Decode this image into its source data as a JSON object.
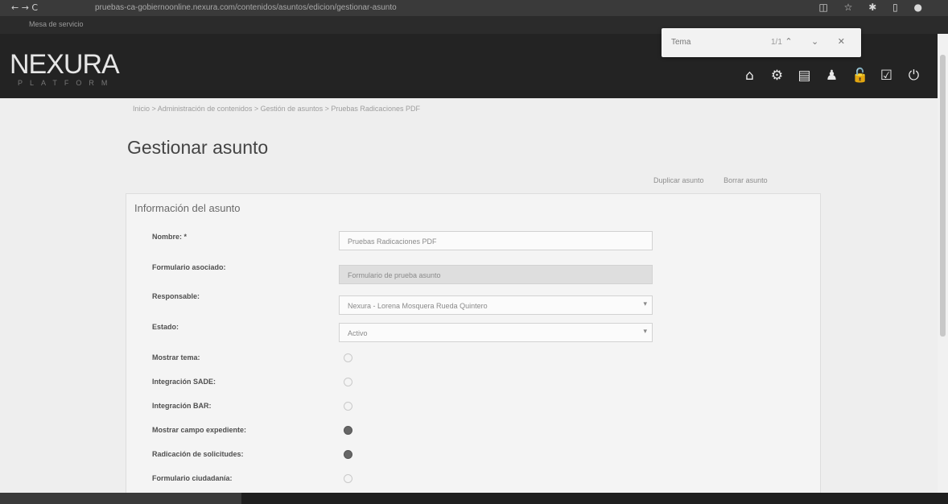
{
  "browser": {
    "nav": "←  →  C",
    "url": "pruebas-ca-gobiernoonline.nexura.com/contenidos/asuntos/edicion/gestionar-asunto",
    "icons": "◫ ☆ ✱ ▯ ●"
  },
  "bookmarks": {
    "label": "Mesa de servicio"
  },
  "find": {
    "query": "Tema",
    "count": "1/1",
    "buttons": "⌃ ⌄ ✕"
  },
  "header": {
    "logo": "NEXURA",
    "logo_sub": "PLATFORM",
    "icons": [
      "home-icon",
      "gear-icon",
      "book-icon",
      "user-icon",
      "unlock-icon",
      "check-square-icon",
      "power-icon"
    ],
    "icon_glyphs": [
      "⌂",
      "⚙",
      "▤",
      "♟",
      "🔓",
      "☑",
      "⏻"
    ]
  },
  "breadcrumb": "Inicio > Administración de contenidos > Gestión de asuntos > Pruebas Radicaciones PDF",
  "page": {
    "title": "Gestionar asunto",
    "actions": [
      "Duplicar asunto",
      "Borrar asunto"
    ]
  },
  "form": {
    "panel_title": "Información del asunto",
    "fields": {
      "nombre": {
        "label": "Nombre: *",
        "value": "Pruebas Radicaciones PDF"
      },
      "formulario": {
        "label": "Formulario asociado:",
        "value": "Formulario de prueba asunto"
      },
      "responsable": {
        "label": "Responsable:",
        "value": "Nexura - Lorena Mosquera Rueda Quintero"
      },
      "estado": {
        "label": "Estado:",
        "value": "Activo"
      },
      "mostrar_tema": {
        "label": "Mostrar tema:",
        "checked": false
      },
      "integracion_sade": {
        "label": "Integración SADE:",
        "checked": false
      },
      "integracion_bar": {
        "label": "Integración BAR:",
        "checked": false
      },
      "mostrar_campo": {
        "label": "Mostrar campo expediente:",
        "checked": true
      },
      "radicacion": {
        "label": "Radicación de solicitudes:",
        "checked": true
      },
      "formulario_ciudadano": {
        "label": "Formulario ciudadanía:",
        "checked": false
      }
    }
  }
}
